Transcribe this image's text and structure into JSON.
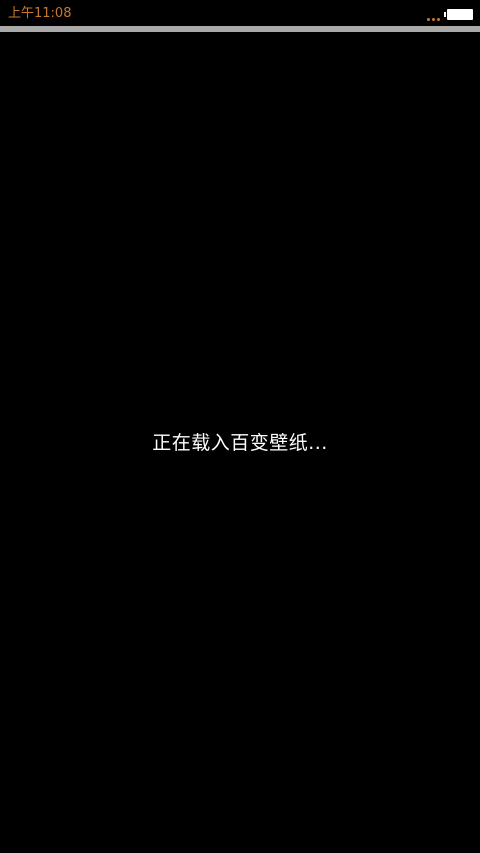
{
  "status_bar": {
    "time": "上午11:08",
    "signal_icon": "signal-dots-icon",
    "battery_icon": "battery-icon",
    "accent_color": "#c8782a"
  },
  "main": {
    "loading_text": "正在载入百变壁纸..."
  },
  "colors": {
    "background": "#000000",
    "divider": "#a9a9a9",
    "text": "#ffffff"
  }
}
